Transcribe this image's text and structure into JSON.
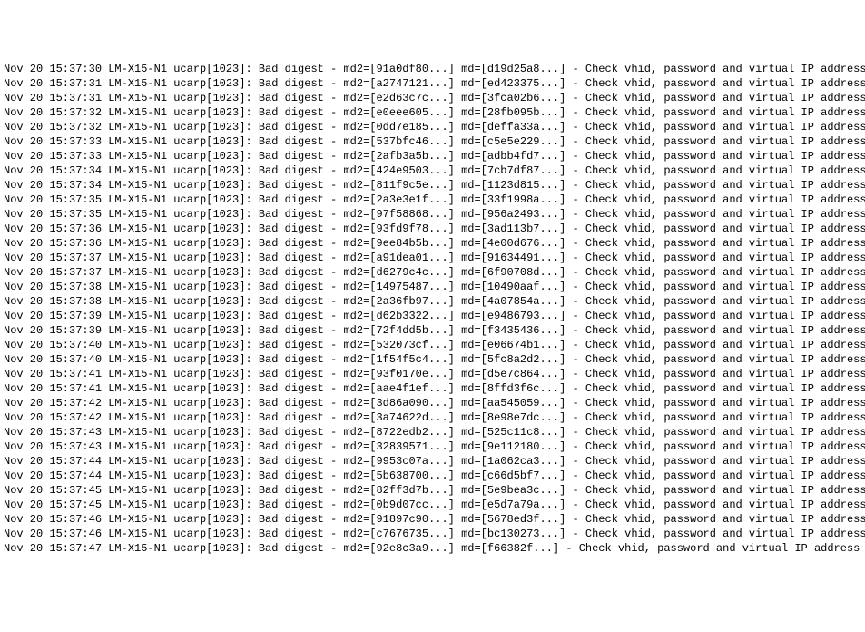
{
  "host": "LM-X15-N1",
  "proc": "ucarp[1023]",
  "msg_prefix": "Bad digest -",
  "msg_suffix": "- Check vhid, password and virtual IP address",
  "date": "Nov 20",
  "lines": [
    {
      "time": "15:37:30",
      "md2": "91a0df80",
      "md": "d19d25a8"
    },
    {
      "time": "15:37:31",
      "md2": "a2747121",
      "md": "ed423375"
    },
    {
      "time": "15:37:31",
      "md2": "e2d63c7c",
      "md": "3fca02b6"
    },
    {
      "time": "15:37:32",
      "md2": "e0eee605",
      "md": "28fb095b"
    },
    {
      "time": "15:37:32",
      "md2": "0dd7e185",
      "md": "deffa33a"
    },
    {
      "time": "15:37:33",
      "md2": "537bfc46",
      "md": "c5e5e229"
    },
    {
      "time": "15:37:33",
      "md2": "2afb3a5b",
      "md": "adbb4fd7"
    },
    {
      "time": "15:37:34",
      "md2": "424e9503",
      "md": "7cb7df87"
    },
    {
      "time": "15:37:34",
      "md2": "811f9c5e",
      "md": "1123d815"
    },
    {
      "time": "15:37:35",
      "md2": "2a3e3e1f",
      "md": "33f1998a"
    },
    {
      "time": "15:37:35",
      "md2": "97f58868",
      "md": "956a2493"
    },
    {
      "time": "15:37:36",
      "md2": "93fd9f78",
      "md": "3ad113b7"
    },
    {
      "time": "15:37:36",
      "md2": "9ee84b5b",
      "md": "4e00d676"
    },
    {
      "time": "15:37:37",
      "md2": "a91dea01",
      "md": "91634491"
    },
    {
      "time": "15:37:37",
      "md2": "d6279c4c",
      "md": "6f90708d"
    },
    {
      "time": "15:37:38",
      "md2": "14975487",
      "md": "10490aaf"
    },
    {
      "time": "15:37:38",
      "md2": "2a36fb97",
      "md": "4a07854a"
    },
    {
      "time": "15:37:39",
      "md2": "d62b3322",
      "md": "e9486793"
    },
    {
      "time": "15:37:39",
      "md2": "72f4dd5b",
      "md": "f3435436"
    },
    {
      "time": "15:37:40",
      "md2": "532073cf",
      "md": "e06674b1"
    },
    {
      "time": "15:37:40",
      "md2": "1f54f5c4",
      "md": "5fc8a2d2"
    },
    {
      "time": "15:37:41",
      "md2": "93f0170e",
      "md": "d5e7c864"
    },
    {
      "time": "15:37:41",
      "md2": "aae4f1ef",
      "md": "8ffd3f6c"
    },
    {
      "time": "15:37:42",
      "md2": "3d86a090",
      "md": "aa545059"
    },
    {
      "time": "15:37:42",
      "md2": "3a74622d",
      "md": "8e98e7dc"
    },
    {
      "time": "15:37:43",
      "md2": "8722edb2",
      "md": "525c11c8"
    },
    {
      "time": "15:37:43",
      "md2": "32839571",
      "md": "9e112180"
    },
    {
      "time": "15:37:44",
      "md2": "9953c07a",
      "md": "1a062ca3"
    },
    {
      "time": "15:37:44",
      "md2": "5b638700",
      "md": "c66d5bf7"
    },
    {
      "time": "15:37:45",
      "md2": "82ff3d7b",
      "md": "5e9bea3c"
    },
    {
      "time": "15:37:45",
      "md2": "0b9d07cc",
      "md": "e5d7a79a"
    },
    {
      "time": "15:37:46",
      "md2": "91897c90",
      "md": "5678ed3f"
    },
    {
      "time": "15:37:46",
      "md2": "c7676735",
      "md": "bc130273"
    },
    {
      "time": "15:37:47",
      "md2": "92e8c3a9",
      "md": "f66382f"
    }
  ]
}
